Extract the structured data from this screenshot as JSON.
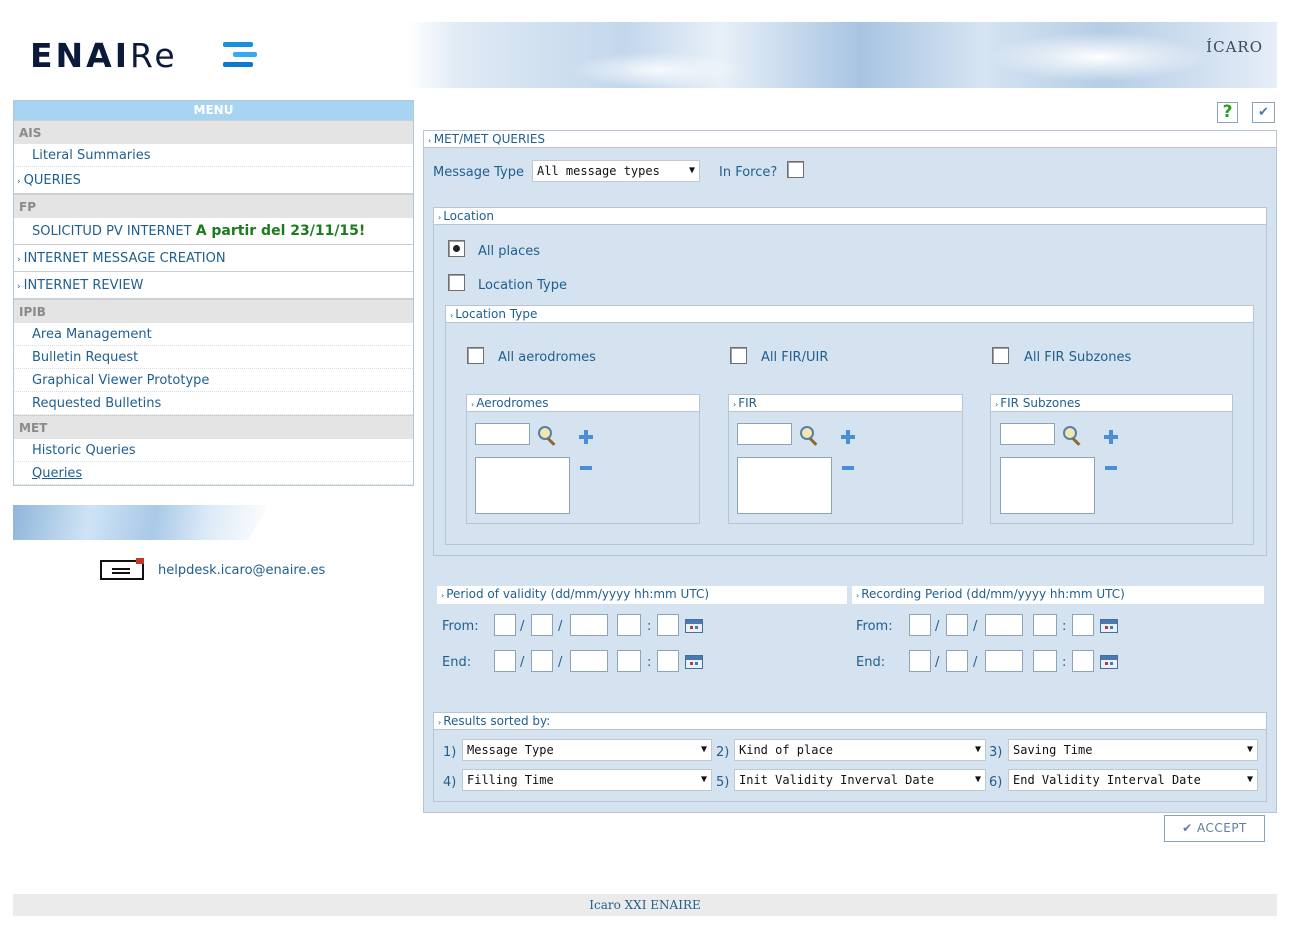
{
  "brand": {
    "logo_text": "ENAIRE",
    "app_logo": "ÍCARO"
  },
  "menu": {
    "title": "MENU",
    "sections": [
      {
        "name": "AIS",
        "items": [
          "Literal Summaries",
          "QUERIES"
        ]
      },
      {
        "name": "FP",
        "items": [
          "SOLICITUD PV INTERNET",
          "INTERNET MESSAGE CREATION",
          "INTERNET REVIEW"
        ],
        "highlight": "A partir del 23/11/15!"
      },
      {
        "name": "IPIB",
        "items": [
          "Area Management",
          "Bulletin Request",
          "Graphical Viewer Prototype",
          "Requested Bulletins"
        ]
      },
      {
        "name": "MET",
        "items": [
          "Historic Queries",
          "Queries"
        ]
      }
    ]
  },
  "helpdesk": {
    "email": "helpdesk.icaro@enaire.es"
  },
  "toolbar": {
    "help_icon": "?",
    "check_icon": "✔"
  },
  "main": {
    "title": "MET/MET QUERIES",
    "message_type_label": "Message Type",
    "message_type_value": "All message types",
    "in_force_label": "In Force?",
    "location": {
      "title": "Location",
      "all_places": "All places",
      "location_type": "Location Type",
      "selected": "All places",
      "type_pane": {
        "title": "Location Type",
        "all_aerodromes": "All aerodromes",
        "all_fir_uir": "All FIR/UIR",
        "all_fir_subzones": "All FIR Subzones",
        "aerodromes": "Aerodromes",
        "fir": "FIR",
        "fir_subzones": "FIR Subzones"
      }
    },
    "validity": {
      "title": "Period of validity (dd/mm/yyyy hh:mm UTC)",
      "from": "From:",
      "end": "End:"
    },
    "recording": {
      "title": "Recording Period (dd/mm/yyyy hh:mm UTC)",
      "from": "From:",
      "end": "End:"
    },
    "sorted": {
      "title": "Results sorted by:",
      "fields": [
        {
          "n": "1)",
          "value": "Message Type"
        },
        {
          "n": "2)",
          "value": "Kind of place"
        },
        {
          "n": "3)",
          "value": "Saving Time"
        },
        {
          "n": "4)",
          "value": "Filling Time"
        },
        {
          "n": "5)",
          "value": "Init Validity Inverval Date"
        },
        {
          "n": "6)",
          "value": "End Validity Interval Date"
        }
      ]
    },
    "accept": "ACCEPT"
  },
  "footer": "Icaro XXI ENAIRE"
}
